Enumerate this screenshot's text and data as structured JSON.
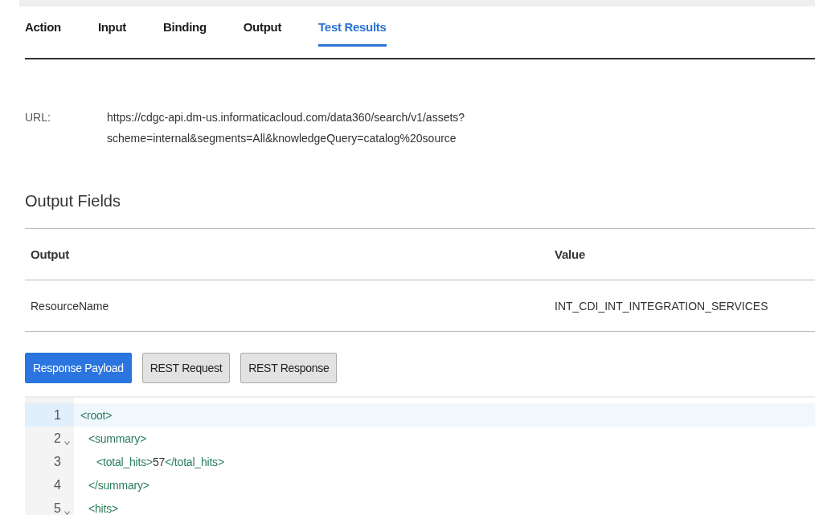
{
  "tabs": [
    {
      "label": "Action",
      "selected": false
    },
    {
      "label": "Input",
      "selected": false
    },
    {
      "label": "Binding",
      "selected": false
    },
    {
      "label": "Output",
      "selected": false
    },
    {
      "label": "Test Results",
      "selected": true
    }
  ],
  "url": {
    "label": "URL:",
    "value": "https://cdgc-api.dm-us.informaticacloud.com/data360/search/v1/assets?scheme=internal&segments=All&knowledgeQuery=catalog%20source"
  },
  "output_fields": {
    "title": "Output Fields",
    "columns": [
      "Output",
      "Value"
    ],
    "rows": [
      [
        "ResourceName",
        "INT_CDI_INT_INTEGRATION_SERVICES"
      ]
    ]
  },
  "view_buttons": [
    {
      "label": "Response Payload",
      "selected": true
    },
    {
      "label": "REST Request",
      "selected": false
    },
    {
      "label": "REST Response",
      "selected": false
    }
  ],
  "editor": {
    "lines": [
      {
        "number": "1",
        "selected": true,
        "foldable": false,
        "segments": [
          {
            "kind": "tag",
            "text": "<root>"
          }
        ],
        "children": [
          {
            "number": "2",
            "selected": false,
            "foldable": true,
            "segments": [
              {
                "kind": "tag",
                "text": "<summary>"
              }
            ],
            "children": [
              {
                "number": "3",
                "selected": false,
                "foldable": false,
                "segments": [
                  {
                    "kind": "tag",
                    "text": "<total_hits>"
                  },
                  {
                    "kind": "text",
                    "text": "57"
                  },
                  {
                    "kind": "tag",
                    "text": "</total_hits>"
                  }
                ]
              }
            ]
          },
          {
            "number": "4",
            "selected": false,
            "foldable": false,
            "segments": [
              {
                "kind": "tag",
                "text": "</summary>"
              }
            ]
          },
          {
            "number": "5",
            "selected": false,
            "foldable": true,
            "segments": [
              {
                "kind": "tag",
                "text": "<hits>"
              }
            ]
          }
        ]
      }
    ]
  }
}
